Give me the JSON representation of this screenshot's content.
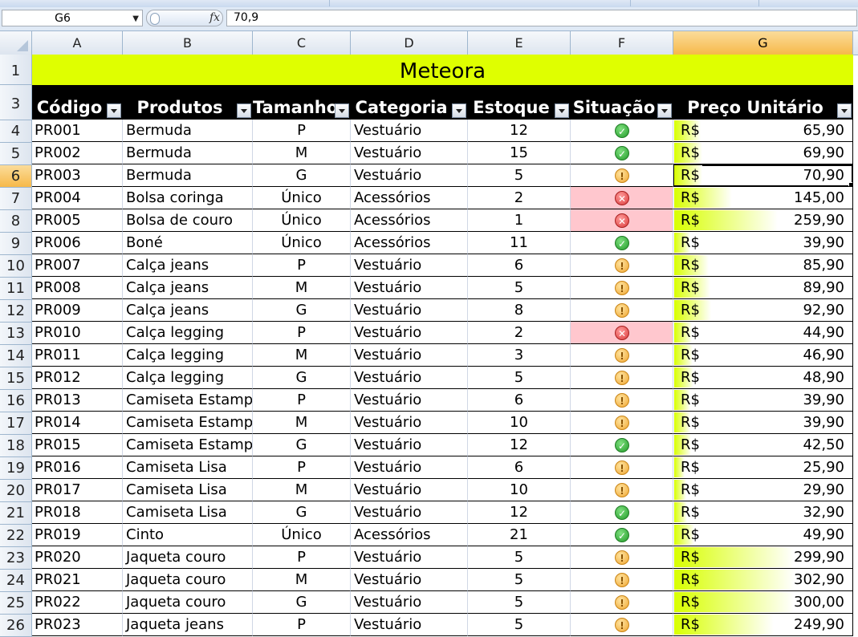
{
  "formula_bar": {
    "name_box": "G6",
    "formula": "70,9",
    "fx_label": "fx"
  },
  "columns": [
    "A",
    "B",
    "C",
    "D",
    "E",
    "F",
    "G"
  ],
  "selected_column": "G",
  "row_numbers": [
    "1",
    "3",
    "4",
    "5",
    "6",
    "7",
    "8",
    "9",
    "10",
    "11",
    "12",
    "13",
    "14",
    "15",
    "16",
    "17",
    "18",
    "19",
    "20",
    "21",
    "22",
    "23",
    "24",
    "25",
    "26"
  ],
  "selected_row": "6",
  "sheet": {
    "title": "Meteora",
    "title_bg": "#dfff00",
    "headers": [
      "Código",
      "Produtos",
      "Tamanho",
      "Categoria",
      "Estoque",
      "Situação",
      "Preço Unitário"
    ],
    "currency": "R$",
    "price_max": 302.9,
    "rows": [
      {
        "row": "4",
        "code": "PR001",
        "product": "Bermuda",
        "size": "P",
        "category": "Vestuário",
        "stock": "12",
        "status": "ok",
        "price": "65,90",
        "price_value": 65.9
      },
      {
        "row": "5",
        "code": "PR002",
        "product": "Bermuda",
        "size": "M",
        "category": "Vestuário",
        "stock": "15",
        "status": "ok",
        "price": "69,90",
        "price_value": 69.9
      },
      {
        "row": "6",
        "code": "PR003",
        "product": "Bermuda",
        "size": "G",
        "category": "Vestuário",
        "stock": "5",
        "status": "warn",
        "price": "70,90",
        "price_value": 70.9
      },
      {
        "row": "7",
        "code": "PR004",
        "product": "Bolsa coringa",
        "size": "Único",
        "category": "Acessórios",
        "stock": "2",
        "status": "err",
        "price": "145,00",
        "price_value": 145.0
      },
      {
        "row": "8",
        "code": "PR005",
        "product": "Bolsa de couro",
        "size": "Único",
        "category": "Acessórios",
        "stock": "1",
        "status": "err",
        "price": "259,90",
        "price_value": 259.9
      },
      {
        "row": "9",
        "code": "PR006",
        "product": "Boné",
        "size": "Único",
        "category": "Acessórios",
        "stock": "11",
        "status": "ok",
        "price": "39,90",
        "price_value": 39.9
      },
      {
        "row": "10",
        "code": "PR007",
        "product": "Calça jeans",
        "size": "P",
        "category": "Vestuário",
        "stock": "6",
        "status": "warn",
        "price": "85,90",
        "price_value": 85.9
      },
      {
        "row": "11",
        "code": "PR008",
        "product": "Calça jeans",
        "size": "M",
        "category": "Vestuário",
        "stock": "5",
        "status": "warn",
        "price": "89,90",
        "price_value": 89.9
      },
      {
        "row": "12",
        "code": "PR009",
        "product": "Calça jeans",
        "size": "G",
        "category": "Vestuário",
        "stock": "8",
        "status": "warn",
        "price": "92,90",
        "price_value": 92.9
      },
      {
        "row": "13",
        "code": "PR010",
        "product": "Calça legging",
        "size": "P",
        "category": "Vestuário",
        "stock": "2",
        "status": "err",
        "price": "44,90",
        "price_value": 44.9
      },
      {
        "row": "14",
        "code": "PR011",
        "product": "Calça legging",
        "size": "M",
        "category": "Vestuário",
        "stock": "3",
        "status": "warn",
        "price": "46,90",
        "price_value": 46.9
      },
      {
        "row": "15",
        "code": "PR012",
        "product": "Calça legging",
        "size": "G",
        "category": "Vestuário",
        "stock": "5",
        "status": "warn",
        "price": "48,90",
        "price_value": 48.9
      },
      {
        "row": "16",
        "code": "PR013",
        "product": "Camiseta Estampa",
        "size": "P",
        "category": "Vestuário",
        "stock": "6",
        "status": "warn",
        "price": "39,90",
        "price_value": 39.9
      },
      {
        "row": "17",
        "code": "PR014",
        "product": "Camiseta Estampa",
        "size": "M",
        "category": "Vestuário",
        "stock": "10",
        "status": "warn",
        "price": "39,90",
        "price_value": 39.9
      },
      {
        "row": "18",
        "code": "PR015",
        "product": "Camiseta Estampa",
        "size": "G",
        "category": "Vestuário",
        "stock": "12",
        "status": "ok",
        "price": "42,50",
        "price_value": 42.5
      },
      {
        "row": "19",
        "code": "PR016",
        "product": "Camiseta Lisa",
        "size": "P",
        "category": "Vestuário",
        "stock": "6",
        "status": "warn",
        "price": "25,90",
        "price_value": 25.9
      },
      {
        "row": "20",
        "code": "PR017",
        "product": "Camiseta Lisa",
        "size": "M",
        "category": "Vestuário",
        "stock": "10",
        "status": "warn",
        "price": "29,90",
        "price_value": 29.9
      },
      {
        "row": "21",
        "code": "PR018",
        "product": "Camiseta Lisa",
        "size": "G",
        "category": "Vestuário",
        "stock": "12",
        "status": "ok",
        "price": "32,90",
        "price_value": 32.9
      },
      {
        "row": "22",
        "code": "PR019",
        "product": "Cinto",
        "size": "Único",
        "category": "Acessórios",
        "stock": "21",
        "status": "ok",
        "price": "49,90",
        "price_value": 49.9
      },
      {
        "row": "23",
        "code": "PR020",
        "product": "Jaqueta couro",
        "size": "P",
        "category": "Vestuário",
        "stock": "5",
        "status": "warn",
        "price": "299,90",
        "price_value": 299.9
      },
      {
        "row": "24",
        "code": "PR021",
        "product": "Jaqueta couro",
        "size": "M",
        "category": "Vestuário",
        "stock": "5",
        "status": "warn",
        "price": "302,90",
        "price_value": 302.9
      },
      {
        "row": "25",
        "code": "PR022",
        "product": "Jaqueta couro",
        "size": "G",
        "category": "Vestuário",
        "stock": "5",
        "status": "warn",
        "price": "300,00",
        "price_value": 300.0
      },
      {
        "row": "26",
        "code": "PR023",
        "product": "Jaqueta jeans",
        "size": "P",
        "category": "Vestuário",
        "stock": "5",
        "status": "warn",
        "price": "249,90",
        "price_value": 249.9
      }
    ]
  },
  "icons": {
    "ok": "check-circle-icon",
    "warn": "exclamation-circle-icon",
    "err": "x-circle-icon"
  }
}
